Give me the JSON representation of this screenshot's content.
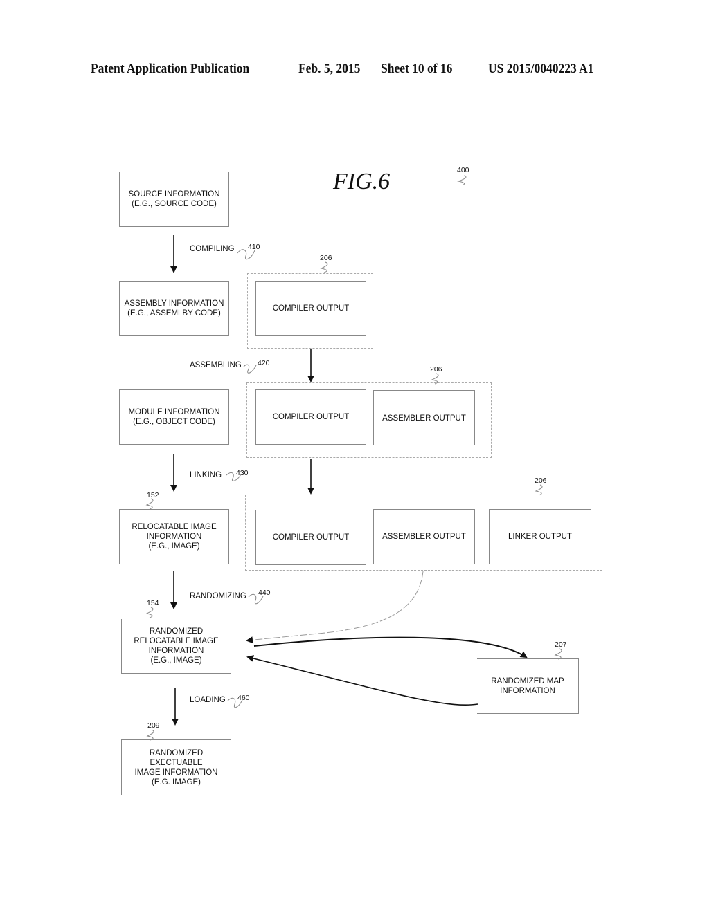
{
  "header": {
    "publication": "Patent Application Publication",
    "date": "Feb. 5, 2015",
    "sheet": "Sheet 10 of 16",
    "number": "US 2015/0040223 A1"
  },
  "figure": {
    "title": "FIG.6",
    "ref": "400"
  },
  "left_column": {
    "source": "SOURCE INFORMATION\n(E.G., SOURCE CODE)",
    "assembly": "ASSEMBLY INFORMATION\n(E.G., ASSEMLBY CODE)",
    "module": "MODULE INFORMATION\n(E.G., OBJECT CODE)",
    "relocatable": "RELOCATABLE IMAGE\nINFORMATION\n(E.G., IMAGE)",
    "relocatable_ref": "152",
    "randomized": "RANDOMIZED\nRELOCATABLE IMAGE\nINFORMATION\n(E.G., IMAGE)",
    "randomized_ref": "154",
    "executable": "RANDOMIZED\nEXECTUABLE\nIMAGE INFORMATION\n(E.G. IMAGE)",
    "executable_ref": "209"
  },
  "steps": {
    "compiling": "COMPILING",
    "compiling_ref": "410",
    "assembling": "ASSEMBLING",
    "assembling_ref": "420",
    "linking": "LINKING",
    "linking_ref": "430",
    "randomizing": "RANDOMIZING",
    "randomizing_ref": "440",
    "loading": "LOADING",
    "loading_ref": "460"
  },
  "outputs": {
    "group_ref": "206",
    "compiler": "COMPILER OUTPUT",
    "assembler": "ASSEMBLER OUTPUT",
    "linker": "LINKER OUTPUT"
  },
  "map": {
    "label": "RANDOMIZED MAP\nINFORMATION",
    "ref": "207"
  }
}
